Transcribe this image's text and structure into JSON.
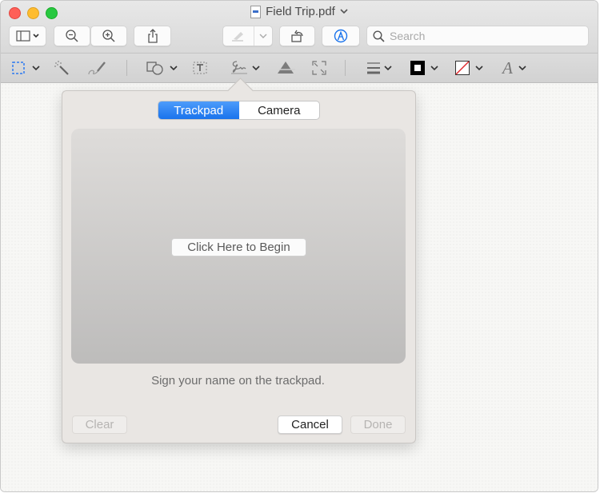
{
  "window": {
    "title": "Field Trip.pdf",
    "traffic_lights": [
      "close",
      "minimize",
      "zoom"
    ]
  },
  "toolbar": {
    "sidebar_icon": "sidebar-icon",
    "zoom_out_icon": "zoom-out-icon",
    "zoom_in_icon": "zoom-in-icon",
    "share_icon": "share-icon",
    "highlight_icon": "highlighter-icon",
    "rotate_icon": "rotate-icon",
    "markup_icon": "markup-pen-icon",
    "search_placeholder": "Search"
  },
  "markup_toolbar": {
    "tools": [
      {
        "name": "rectangular-selection",
        "icon": "dashed-rect-icon",
        "has_menu": true
      },
      {
        "name": "instant-alpha",
        "icon": "magic-wand-icon",
        "has_menu": false
      },
      {
        "name": "sketch",
        "icon": "sketch-icon",
        "has_menu": false
      },
      {
        "name": "shapes",
        "icon": "shapes-icon",
        "has_menu": true
      },
      {
        "name": "text",
        "icon": "text-box-icon",
        "has_menu": false
      },
      {
        "name": "sign",
        "icon": "signature-icon",
        "has_menu": true
      },
      {
        "name": "adjust-color",
        "icon": "prism-icon",
        "has_menu": false
      },
      {
        "name": "adjust-size",
        "icon": "resize-icon",
        "has_menu": false
      },
      {
        "name": "shape-style",
        "icon": "line-weight-icon",
        "has_menu": true
      },
      {
        "name": "border-color",
        "icon": "border-color-icon",
        "has_menu": true
      },
      {
        "name": "fill-color",
        "icon": "fill-color-icon",
        "has_menu": true
      },
      {
        "name": "text-style",
        "icon": "font-icon",
        "has_menu": true
      }
    ],
    "accent_color": "#1a73ec"
  },
  "signature_popover": {
    "tabs": [
      {
        "label": "Trackpad",
        "active": true
      },
      {
        "label": "Camera",
        "active": false
      }
    ],
    "begin_button": "Click Here to Begin",
    "hint": "Sign your name on the trackpad.",
    "buttons": {
      "clear": {
        "label": "Clear",
        "enabled": false
      },
      "cancel": {
        "label": "Cancel",
        "enabled": true
      },
      "done": {
        "label": "Done",
        "enabled": false
      }
    }
  }
}
